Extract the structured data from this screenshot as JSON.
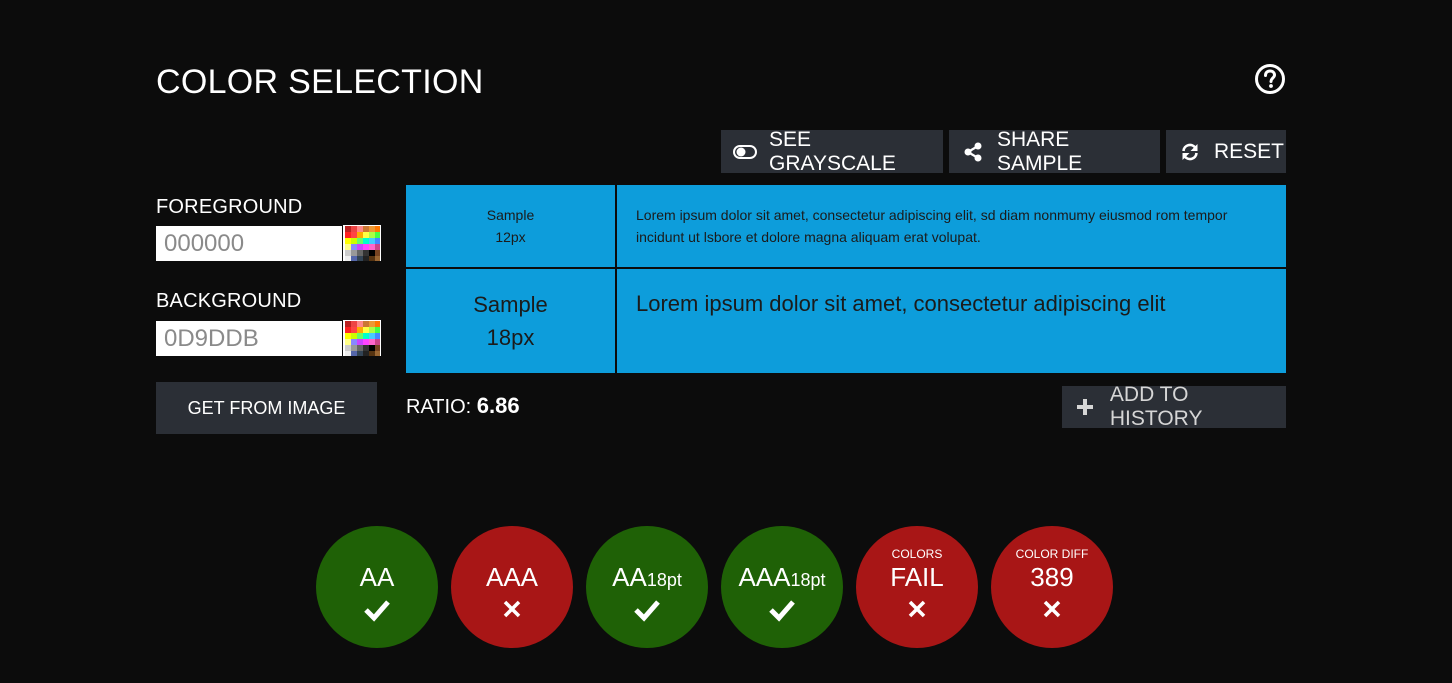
{
  "page": {
    "title": "COLOR SELECTION"
  },
  "toolbar": {
    "grayscale_label": "SEE GRAYSCALE",
    "share_label": "SHARE SAMPLE",
    "reset_label": "RESET"
  },
  "foreground": {
    "label": "FOREGROUND",
    "value": "000000"
  },
  "background": {
    "label": "BACKGROUND",
    "value": "0D9DDB"
  },
  "get_from_image_label": "GET FROM IMAGE",
  "samples": {
    "small_label_line1": "Sample",
    "small_label_line2": "12px",
    "large_label_line1": "Sample",
    "large_label_line2": "18px",
    "small_text": "Lorem ipsum dolor sit amet, consectetur adipiscing elit, sd diam nonmumy eiusmod rom tempor incidunt ut lsbore et dolore magna aliquam erat volupat.",
    "large_text": "Lorem ipsum dolor sit amet, consectetur adipiscing elit",
    "sample_color": "#0d9ddb",
    "text_color": "#000000"
  },
  "ratio": {
    "label": "RATIO:",
    "value": "6.86"
  },
  "add_to_history_label": "ADD TO HISTORY",
  "results": [
    {
      "top": "",
      "main": "AA",
      "suffix": "",
      "status": "pass"
    },
    {
      "top": "",
      "main": "AAA",
      "suffix": "",
      "status": "fail"
    },
    {
      "top": "",
      "main": "AA",
      "suffix": "18pt",
      "status": "pass"
    },
    {
      "top": "",
      "main": "AAA",
      "suffix": "18pt",
      "status": "pass"
    },
    {
      "top": "COLORS",
      "main": "FAIL",
      "suffix": "",
      "status": "fail"
    },
    {
      "top": "COLOR DIFF",
      "main": "389",
      "suffix": "",
      "status": "fail"
    }
  ],
  "colors": {
    "pass": "#1f6106",
    "fail": "#a81616",
    "button": "#2b2f36"
  },
  "icons": {
    "help": "question-circle-icon",
    "grayscale": "toggle-icon",
    "share": "share-icon",
    "reset": "refresh-icon",
    "add": "plus-icon",
    "pass_mark": "check-icon",
    "fail_mark": "x-icon"
  }
}
